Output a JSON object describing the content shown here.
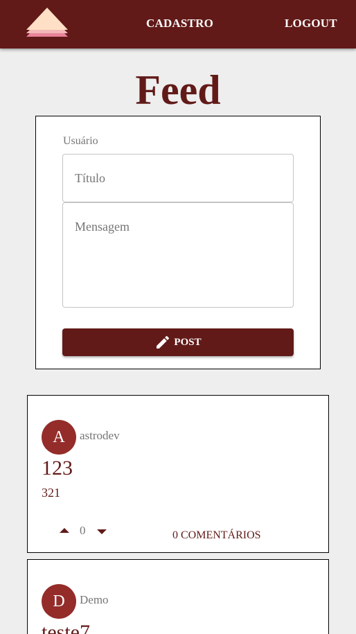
{
  "nav": {
    "cadastro_label": "CADASTRO",
    "logout_label": "LOGOUT"
  },
  "page": {
    "title": "Feed"
  },
  "form": {
    "user_label": "Usuário",
    "title_placeholder": "Título",
    "message_placeholder": "Mensagem",
    "post_label": "POST"
  },
  "posts": [
    {
      "avatar_letter": "A",
      "author": "astrodev",
      "title": "123",
      "body": "321",
      "votes": "0",
      "comments_label": "0 COMENTÁRIOS"
    },
    {
      "avatar_letter": "D",
      "author": "Demo",
      "title": "teste7"
    }
  ],
  "colors": {
    "primary": "#611a18",
    "avatar": "#942c2a",
    "background": "#eeeeee"
  }
}
